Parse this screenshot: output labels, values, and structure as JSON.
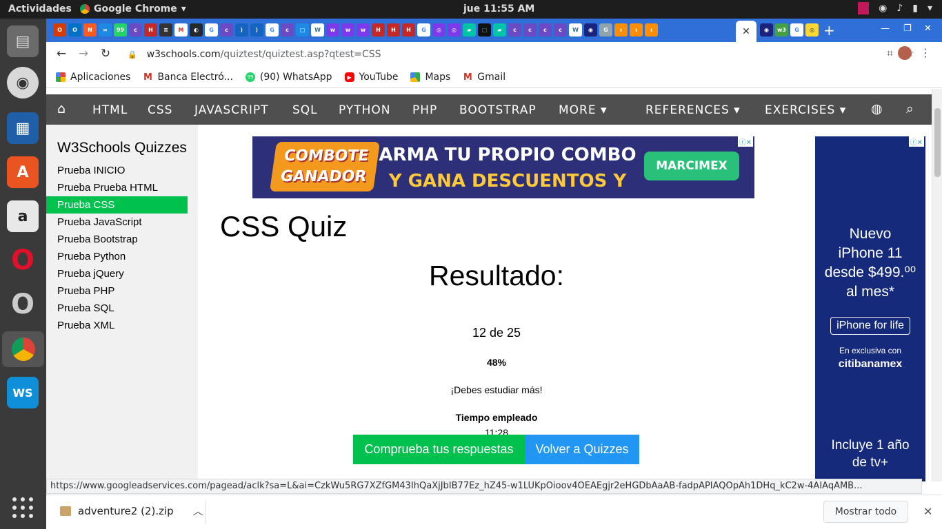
{
  "os": {
    "activities": "Actividades",
    "app_name": "Google Chrome",
    "clock": "jue 11:55 AM"
  },
  "browser": {
    "url_host": "w3schools.com",
    "url_path": "/quiztest/quiztest.asp?qtest=CSS",
    "bookmarks": [
      {
        "label": "Aplicaciones",
        "icon": "apps-grid-icon"
      },
      {
        "label": "Banca Electró...",
        "icon": "gmail-icon"
      },
      {
        "label": "(90) WhatsApp",
        "icon": "whatsapp-icon"
      },
      {
        "label": "YouTube",
        "icon": "youtube-icon"
      },
      {
        "label": "Maps",
        "icon": "maps-icon"
      },
      {
        "label": "Gmail",
        "icon": "gmail-icon"
      }
    ],
    "status_url": "https://www.googleadservices.com/pagead/aclk?sa=L&ai=CzkWu5RG7XZfGM43IhQaXjJbIB77Ez_hZ45-w1LUKpOioov4OEAEgjr2eHGDbAaAB-fadpAPIAQOpAh1DHq_kC2w-4AIAqAMB...",
    "download": {
      "filename": "adventure2 (2).zip",
      "show_all": "Mostrar todo"
    }
  },
  "nav": {
    "items": [
      "HTML",
      "CSS",
      "JAVASCRIPT",
      "SQL",
      "PYTHON",
      "PHP",
      "BOOTSTRAP",
      "MORE ▾",
      "REFERENCES ▾",
      "EXERCISES ▾"
    ]
  },
  "sidebar": {
    "title": "W3Schools Quizzes",
    "items": [
      "Prueba INICIO",
      "Prueba Prueba HTML",
      "Prueba CSS",
      "Prueba JavaScript",
      "Prueba Bootstrap",
      "Prueba Python",
      "Prueba jQuery",
      "Prueba PHP",
      "Prueba SQL",
      "Prueba XML"
    ],
    "active_index": 2
  },
  "ads": {
    "banner_left": "COMBOTE GANADOR",
    "banner_line1": "ARMA TU PROPIO COMBO",
    "banner_line2": "Y GANA DESCUENTOS Y REGALOS",
    "banner_brand": "MARCIMEX",
    "side_line1": "Nuevo",
    "side_line2": "iPhone 11",
    "side_line3": "desde $499.⁰⁰",
    "side_line4": "al mes*",
    "side_life": "iPhone for life",
    "side_excl": "En exclusiva con",
    "side_bank": "citibanamex",
    "side_tv1": "Incluye 1 año",
    "side_tv2": "de tv+"
  },
  "quiz": {
    "title": "CSS Quiz",
    "result_heading": "Resultado:",
    "score": "12 de 25",
    "percent": "48%",
    "message": "¡Debes estudiar más!",
    "time_label": "Tiempo empleado",
    "time_value": "11:28",
    "check_button": "Comprueba tus respuestas",
    "back_button": "Volver a Quizzes"
  }
}
